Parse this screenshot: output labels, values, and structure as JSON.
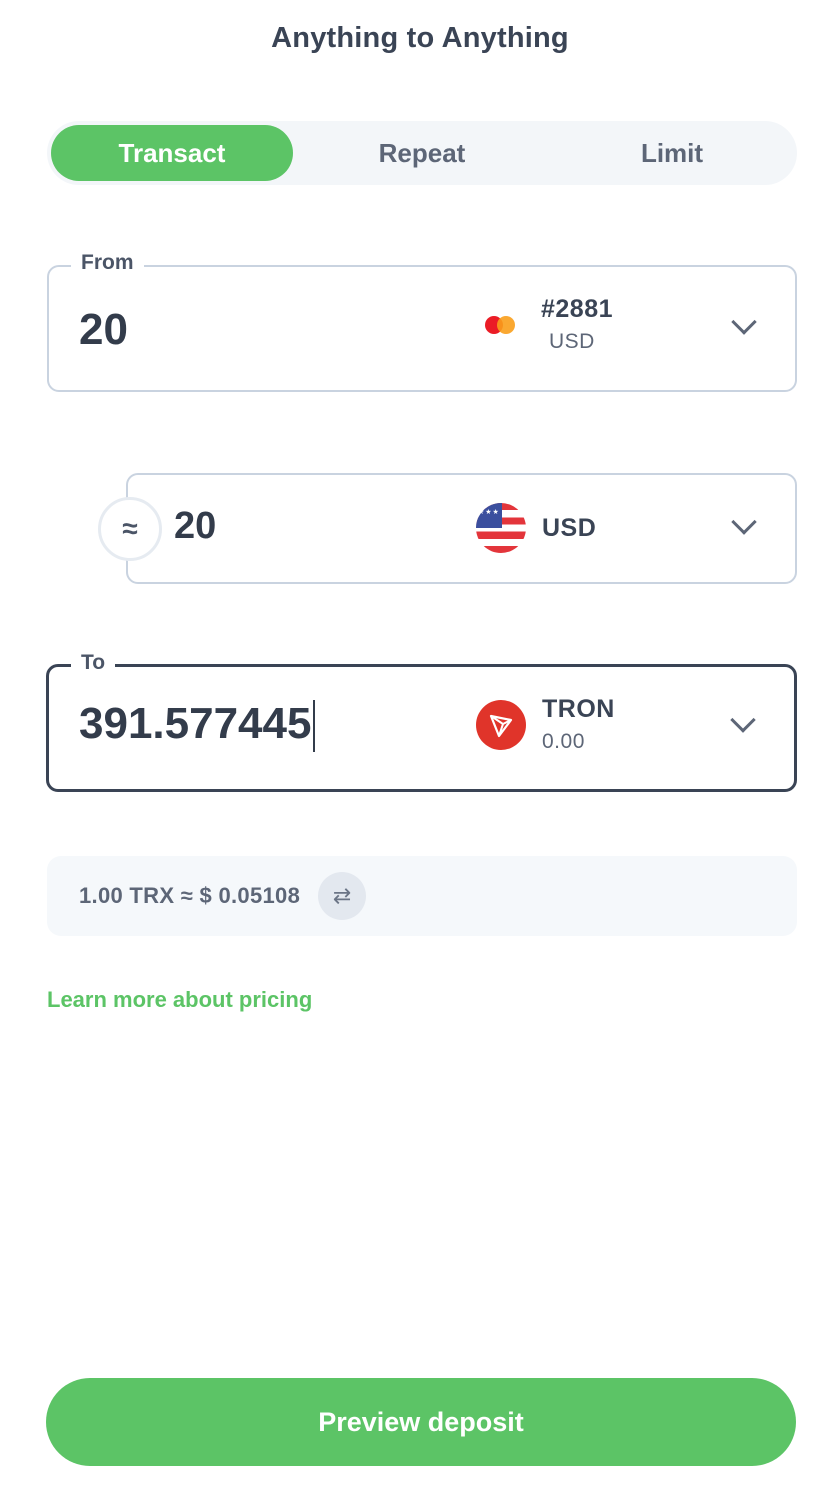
{
  "header": {
    "title": "Anything to Anything"
  },
  "tabs": [
    {
      "label": "Transact",
      "active": true
    },
    {
      "label": "Repeat",
      "active": false
    },
    {
      "label": "Limit",
      "active": false
    }
  ],
  "from": {
    "legend": "From",
    "amount": "20",
    "asset": {
      "icon": "mastercard-icon",
      "name": "#2881",
      "sub": "USD"
    }
  },
  "middle": {
    "amount": "20",
    "asset": {
      "icon": "us-flag-icon",
      "name": "USD"
    }
  },
  "to": {
    "legend": "To",
    "amount": "391.577445",
    "asset": {
      "icon": "tron-icon",
      "name": "TRON",
      "sub": "0.00"
    }
  },
  "rate": {
    "text": "1.00 TRX ≈ $ 0.05108"
  },
  "links": {
    "learn_more": "Learn more about pricing"
  },
  "actions": {
    "preview_label": "Preview deposit"
  },
  "colors": {
    "accent": "#5cc466",
    "tron": "#e0342a",
    "text": "#3a4455"
  }
}
